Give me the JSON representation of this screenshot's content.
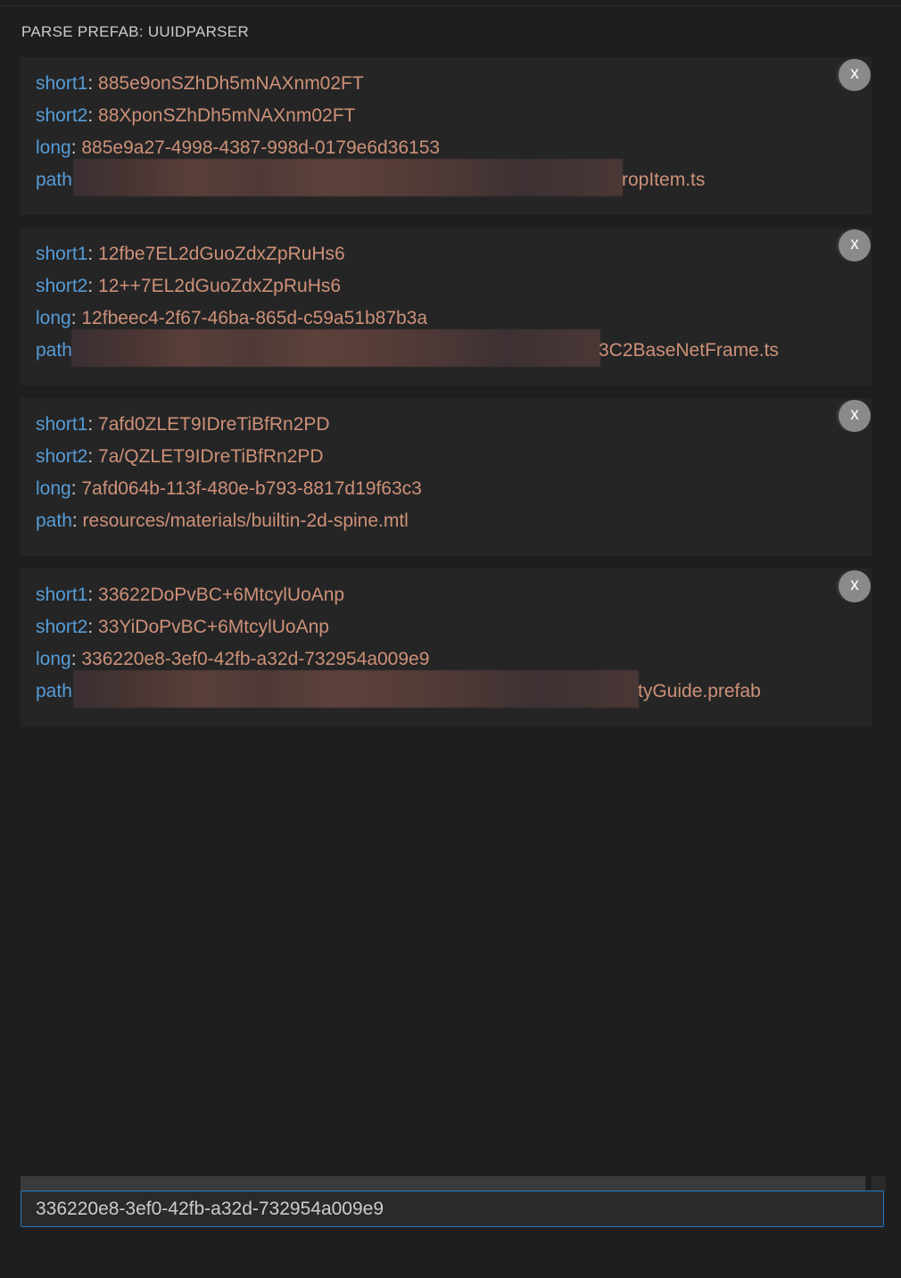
{
  "panel": {
    "title": "PARSE PREFAB: UUIDPARSER"
  },
  "labels": {
    "short1": "short1",
    "short2": "short2",
    "long": "long",
    "path": "path",
    "separator": ": "
  },
  "entries": [
    {
      "short1": "885e9onSZhDh5mNAXnm02FT",
      "short2": "88XponSZhDh5mNAXnm02FT",
      "long": "885e9a27-4998-4387-998d-0179e6d36153",
      "path_label_visible": "path",
      "path_suffix": "ropItem.ts",
      "path_redacted": true,
      "close_label": "x"
    },
    {
      "short1": "12fbe7EL2dGuoZdxZpRuHs6",
      "short2": "12++7EL2dGuoZdxZpRuHs6",
      "long": "12fbeec4-2f67-46ba-865d-c59a51b87b3a",
      "path_label_visible": "path",
      "path_suffix": "3C2BaseNetFrame.ts",
      "path_redacted": true,
      "close_label": "x"
    },
    {
      "short1": "7afd0ZLET9IDreTiBfRn2PD",
      "short2": "7a/QZLET9IDreTiBfRn2PD",
      "long": "7afd064b-113f-480e-b793-8817d19f63c3",
      "path_label_visible": "path",
      "path_suffix": "resources/materials/builtin-2d-spine.mtl",
      "path_redacted": false,
      "close_label": "x"
    },
    {
      "short1": "33622DoPvBC+6MtcylUoAnp",
      "short2": "33YiDoPvBC+6MtcylUoAnp",
      "long": "336220e8-3ef0-42fb-a32d-732954a009e9",
      "path_label_visible": "path",
      "path_suffix": "tyGuide.prefab",
      "path_redacted": true,
      "close_label": "x"
    }
  ],
  "input": {
    "value": "336220e8-3ef0-42fb-a32d-732954a009e9"
  },
  "colors": {
    "background": "#1e1e1e",
    "card": "#252526",
    "key": "#569cd6",
    "value": "#ce9178",
    "focus_border": "#1f7dc9",
    "close_button": "#8a8a8a"
  }
}
